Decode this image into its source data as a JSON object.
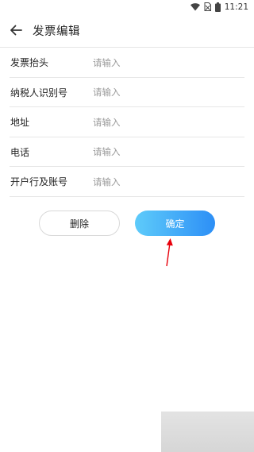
{
  "status_bar": {
    "time": "11:21"
  },
  "header": {
    "title": "发票编辑"
  },
  "form": {
    "fields": [
      {
        "label": "发票抬头",
        "placeholder": "请输入",
        "value": ""
      },
      {
        "label": "纳税人识别号",
        "placeholder": "请输入",
        "value": ""
      },
      {
        "label": "地址",
        "placeholder": "请输入",
        "value": ""
      },
      {
        "label": "电话",
        "placeholder": "请输入",
        "value": ""
      },
      {
        "label": "开户行及账号",
        "placeholder": "请输入",
        "value": ""
      }
    ]
  },
  "actions": {
    "delete_label": "删除",
    "confirm_label": "确定"
  },
  "colors": {
    "confirm_gradient_start": "#5ecbfa",
    "confirm_gradient_end": "#2d8ff6",
    "annotation_arrow": "#e8000b"
  }
}
